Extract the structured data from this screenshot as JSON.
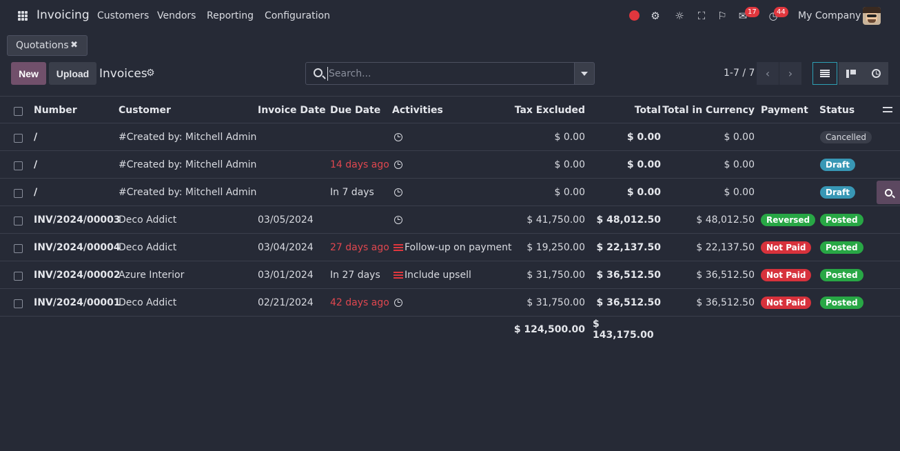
{
  "topnav": {
    "app_name": "Invoicing",
    "menu": [
      "Customers",
      "Vendors",
      "Reporting",
      "Configuration"
    ],
    "messages_count": "17",
    "activities_count": "44",
    "company": "My Company"
  },
  "facet": {
    "label": "Quotations"
  },
  "control": {
    "new_label": "New",
    "upload_label": "Upload",
    "title": "Invoices",
    "search_placeholder": "Search...",
    "pager": "1-7 / 7"
  },
  "table": {
    "headers": [
      "Number",
      "Customer",
      "Invoice Date",
      "Due Date",
      "Activities",
      "Tax Excluded",
      "Total",
      "Total in Currency",
      "Payment",
      "Status"
    ],
    "rows": [
      {
        "number": "/",
        "customer": "#Created by: Mitchell Admin",
        "invoice_date": "",
        "due_date": "",
        "due_overdue": false,
        "activity": "",
        "activity_type": "clock",
        "tax_excluded": "$ 0.00",
        "total": "$ 0.00",
        "total_currency": "$ 0.00",
        "payment": "",
        "payment_type": "",
        "status": "Cancelled",
        "status_type": "cancelled"
      },
      {
        "number": "/",
        "customer": "#Created by: Mitchell Admin",
        "invoice_date": "",
        "due_date": "14 days ago",
        "due_overdue": true,
        "activity": "",
        "activity_type": "clock",
        "tax_excluded": "$ 0.00",
        "total": "$ 0.00",
        "total_currency": "$ 0.00",
        "payment": "",
        "payment_type": "",
        "status": "Draft",
        "status_type": "draft"
      },
      {
        "number": "/",
        "customer": "#Created by: Mitchell Admin",
        "invoice_date": "",
        "due_date": "In 7 days",
        "due_overdue": false,
        "activity": "",
        "activity_type": "clock",
        "tax_excluded": "$ 0.00",
        "total": "$ 0.00",
        "total_currency": "$ 0.00",
        "payment": "",
        "payment_type": "",
        "status": "Draft",
        "status_type": "draft"
      },
      {
        "number": "INV/2024/00003",
        "customer": "Deco Addict",
        "invoice_date": "03/05/2024",
        "due_date": "",
        "due_overdue": false,
        "activity": "",
        "activity_type": "clock",
        "tax_excluded": "$ 41,750.00",
        "total": "$ 48,012.50",
        "total_currency": "$ 48,012.50",
        "payment": "Reversed",
        "payment_type": "reversed",
        "status": "Posted",
        "status_type": "posted"
      },
      {
        "number": "INV/2024/00004",
        "customer": "Deco Addict",
        "invoice_date": "03/04/2024",
        "due_date": "27 days ago",
        "due_overdue": true,
        "activity": "Follow-up on payment",
        "activity_type": "email",
        "tax_excluded": "$ 19,250.00",
        "total": "$ 22,137.50",
        "total_currency": "$ 22,137.50",
        "payment": "Not Paid",
        "payment_type": "notpaid",
        "status": "Posted",
        "status_type": "posted"
      },
      {
        "number": "INV/2024/00002",
        "customer": "Azure Interior",
        "invoice_date": "03/01/2024",
        "due_date": "In 27 days",
        "due_overdue": false,
        "activity": "Include upsell",
        "activity_type": "email",
        "tax_excluded": "$ 31,750.00",
        "total": "$ 36,512.50",
        "total_currency": "$ 36,512.50",
        "payment": "Not Paid",
        "payment_type": "notpaid",
        "status": "Posted",
        "status_type": "posted"
      },
      {
        "number": "INV/2024/00001",
        "customer": "Deco Addict",
        "invoice_date": "02/21/2024",
        "due_date": "42 days ago",
        "due_overdue": true,
        "activity": "",
        "activity_type": "clock",
        "tax_excluded": "$ 31,750.00",
        "total": "$ 36,512.50",
        "total_currency": "$ 36,512.50",
        "payment": "Not Paid",
        "payment_type": "notpaid",
        "status": "Posted",
        "status_type": "posted"
      }
    ],
    "totals": {
      "tax_excluded": "$ 124,500.00",
      "total": "$ 143,175.00"
    }
  },
  "colors": {
    "background": "#262a36",
    "primary": "#71506b",
    "overdue": "#e0474f",
    "posted": "#28a745",
    "draft": "#3897b5",
    "notpaid": "#d7323c"
  }
}
